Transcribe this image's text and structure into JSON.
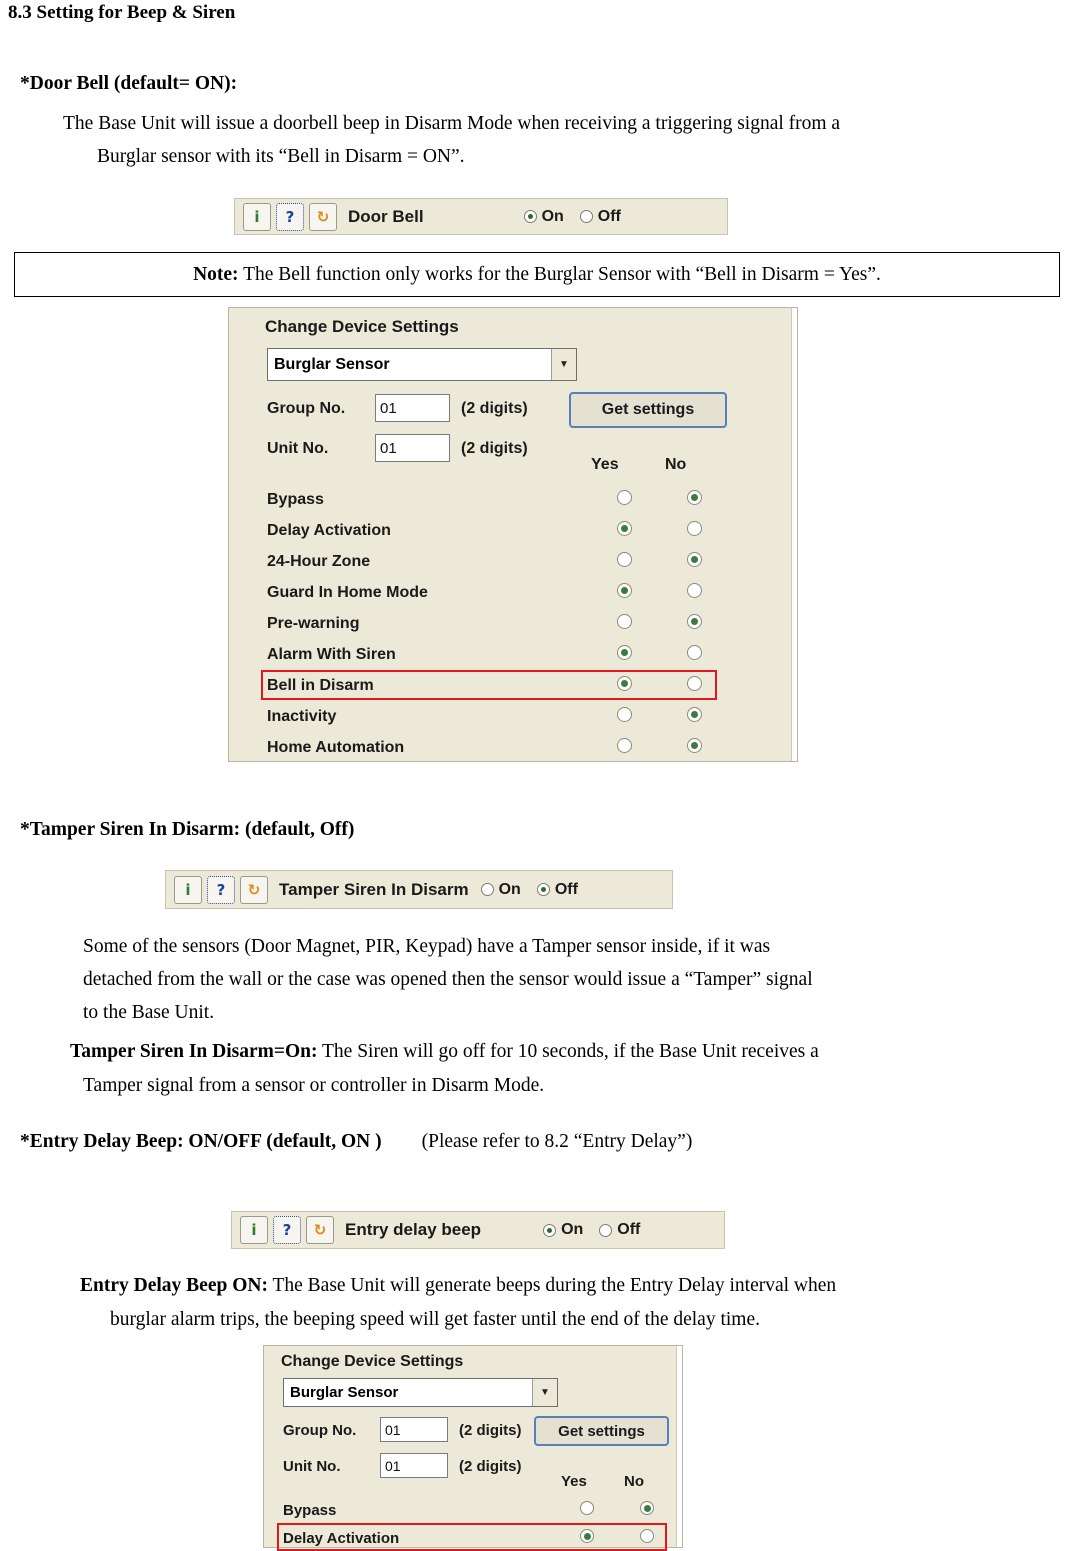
{
  "section": {
    "heading": "8.3 Setting for Beep & Siren"
  },
  "doorbell": {
    "title": "*Door Bell (default= ON):",
    "body_line1": "The Base Unit will issue a doorbell beep in Disarm Mode when receiving a triggering signal from a",
    "body_line2": "Burglar sensor with its “Bell in Disarm = ON”.",
    "widget": {
      "label": "Door Bell",
      "option_on": "On",
      "option_off": "Off",
      "selected": "On",
      "icons": [
        "info-icon",
        "help-icon",
        "refresh-icon"
      ]
    },
    "note_prefix": "Note:",
    "note_text": " The Bell function only works for the Burglar Sensor with “Bell in Disarm = Yes”."
  },
  "panel1": {
    "title": "Change Device Settings",
    "device": "Burglar Sensor",
    "group_label": "Group No.",
    "group_value": "01",
    "group_hint": "(2 digits)",
    "unit_label": "Unit No.",
    "unit_value": "01",
    "unit_hint": "(2 digits)",
    "get_settings": "Get settings",
    "col_yes": "Yes",
    "col_no": "No",
    "rows": [
      {
        "label": "Bypass",
        "value": "No"
      },
      {
        "label": "Delay Activation",
        "value": "Yes"
      },
      {
        "label": "24-Hour Zone",
        "value": "No"
      },
      {
        "label": "Guard In Home Mode",
        "value": "Yes"
      },
      {
        "label": "Pre-warning",
        "value": "No"
      },
      {
        "label": "Alarm With Siren",
        "value": "Yes"
      },
      {
        "label": "Bell in Disarm",
        "value": "Yes",
        "highlight": true
      },
      {
        "label": "Inactivity",
        "value": "No"
      },
      {
        "label": "Home Automation",
        "value": "No"
      }
    ]
  },
  "tamper": {
    "title": "*Tamper Siren In Disarm: (default, Off)",
    "widget": {
      "label": "Tamper Siren In Disarm",
      "option_on": "On",
      "option_off": "Off",
      "selected": "Off"
    },
    "body_line1": "Some of the sensors (Door Magnet, PIR, Keypad) have a Tamper sensor inside, if it was",
    "body_line2": "detached from the wall or the case was opened then the sensor would issue a “Tamper” signal",
    "body_line3": "to the Base Unit.",
    "on_bold": "Tamper Siren In Disarm=On:",
    "on_text": " The Siren will go off for 10 seconds, if the Base Unit receives a",
    "on_text2": "Tamper signal from a sensor or controller in Disarm Mode."
  },
  "entry": {
    "title_bold": "*Entry Delay Beep: ON/OFF (default, ON )",
    "title_ref": "(Please refer to 8.2 “Entry Delay”)",
    "widget": {
      "label": "Entry delay beep",
      "option_on": "On",
      "option_off": "Off",
      "selected": "On"
    },
    "body_bold": "Entry Delay Beep ON:",
    "body_text": " The Base Unit will generate beeps during the Entry Delay interval when",
    "body_line2": "burglar alarm trips, the beeping speed will get faster until the end of the delay time."
  },
  "panel2": {
    "title": "Change Device Settings",
    "device": "Burglar Sensor",
    "group_label": "Group No.",
    "group_value": "01",
    "group_hint": "(2 digits)",
    "unit_label": "Unit No.",
    "unit_value": "01",
    "unit_hint": "(2 digits)",
    "get_settings": "Get settings",
    "col_yes": "Yes",
    "col_no": "No",
    "rows": [
      {
        "label": "Bypass",
        "value": "No"
      },
      {
        "label": "Delay Activation",
        "value": "Yes",
        "highlight": true
      }
    ]
  }
}
